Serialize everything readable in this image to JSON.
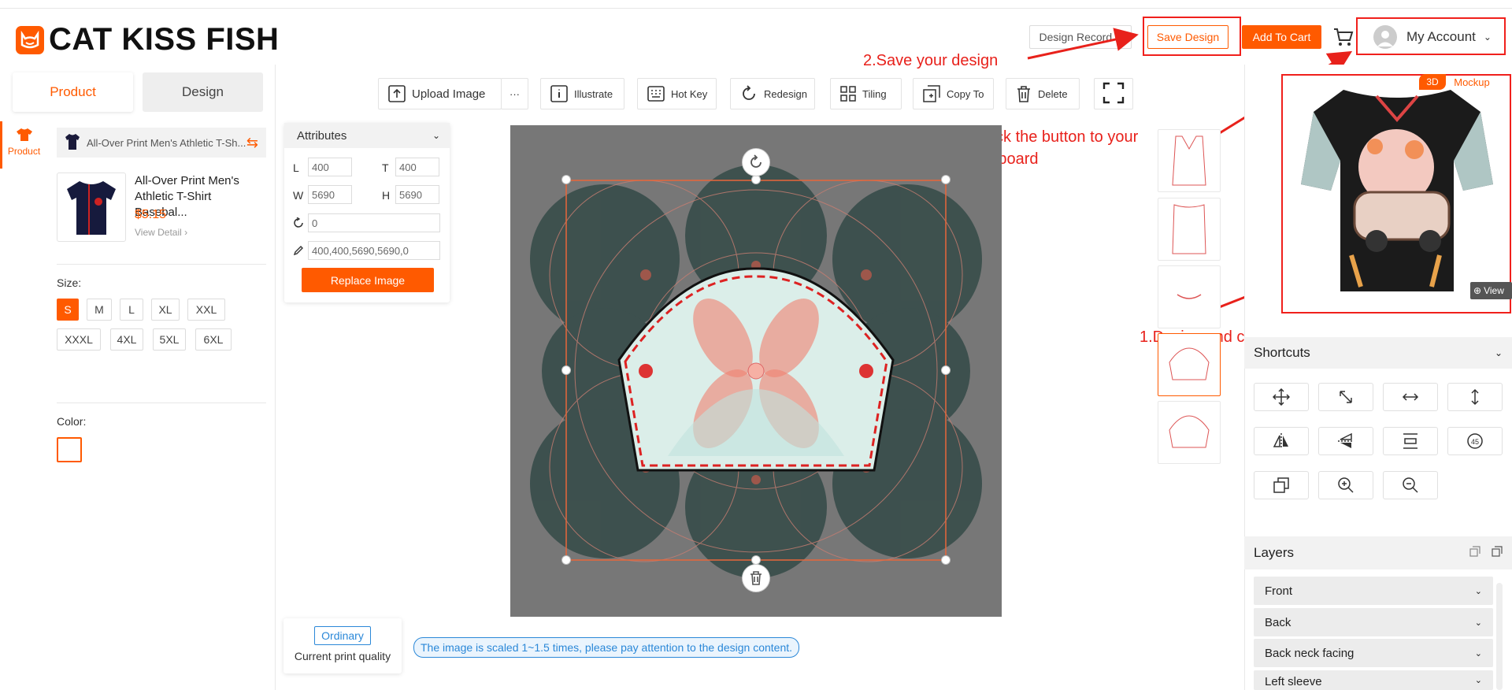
{
  "header": {
    "logo_text": "CAT KISS FISH",
    "design_record": "Design Record",
    "save_design": "Save Design",
    "add_to_cart": "Add To Cart",
    "my_account": "My Account"
  },
  "annotations": {
    "save": "2.Save your design",
    "dashboard": "3.Click the button to your dashboard",
    "design": "1.Design and check your shirt"
  },
  "left": {
    "tabs": [
      "Product",
      "Design"
    ],
    "side_nav_label": "Product",
    "product_select": "All-Over Print Men's Athletic T-Sh...",
    "product_name": "All-Over Print Men's Athletic T-Shirt Basebal...",
    "price": "$5.15",
    "view_detail": "View Detail",
    "size_label": "Size:",
    "sizes": [
      "S",
      "M",
      "L",
      "XL",
      "XXL",
      "XXXL",
      "4XL",
      "5XL",
      "6XL"
    ],
    "selected_size": "S",
    "color_label": "Color:"
  },
  "toolbar": {
    "upload": "Upload Image",
    "more": "···",
    "illustrate": "Illustrate",
    "hotkey": "Hot Key",
    "redesign": "Redesign",
    "tiling": "Tiling",
    "copyto": "Copy To",
    "delete": "Delete"
  },
  "attributes": {
    "title": "Attributes",
    "L_label": "L",
    "L": "400",
    "T_label": "T",
    "T": "400",
    "W_label": "W",
    "W": "5690",
    "H_label": "H",
    "H": "5690",
    "rotation": "0",
    "rect": "400,400,5690,5690,0",
    "replace": "Replace Image"
  },
  "quality": {
    "badge": "Ordinary",
    "label": "Current print quality",
    "notice": "The image is scaled 1~1.5 times, please pay attention to the design content."
  },
  "right": {
    "badge_3d": "3D",
    "badge_mockup": "Mockup",
    "view": "View",
    "shortcuts": "Shortcuts",
    "layers": "Layers",
    "layer_items": [
      "Front",
      "Back",
      "Back neck facing",
      "Left sleeve"
    ]
  },
  "colors": {
    "accent": "#ff5a00",
    "annotation": "#e8211b",
    "info": "#2b88d8"
  }
}
